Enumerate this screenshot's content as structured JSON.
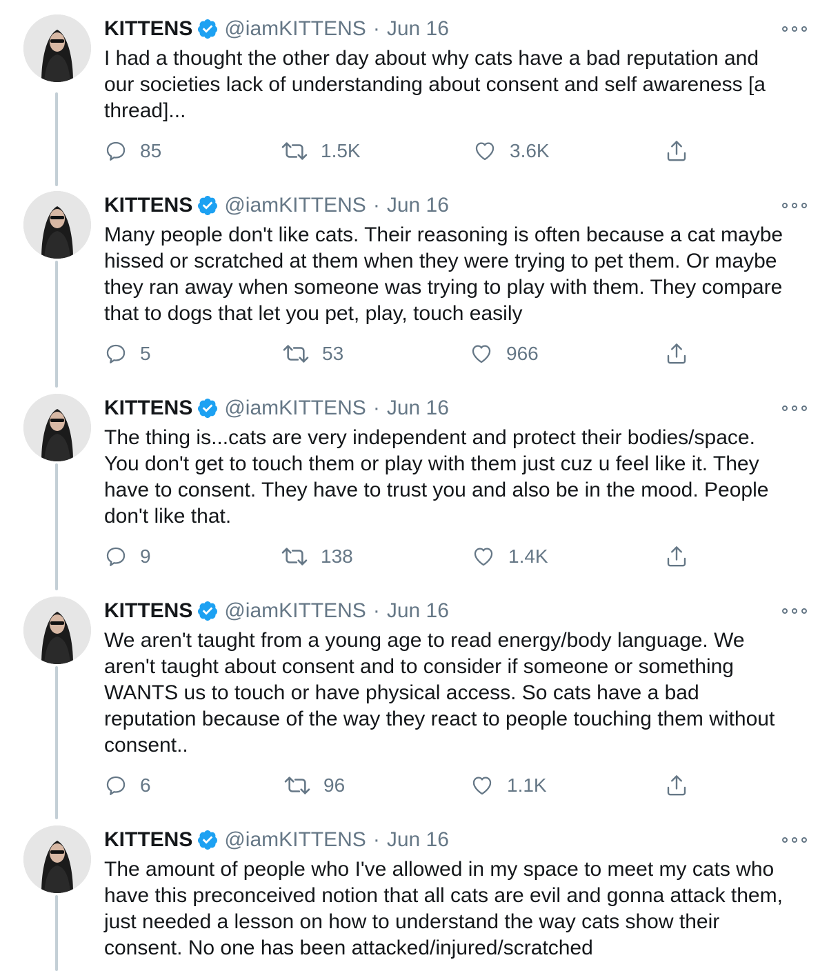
{
  "tweets": [
    {
      "name": "KITTENS",
      "handle": "@iamKITTENS",
      "separator": "·",
      "date": "Jun 16",
      "text": "I had a thought the other day about why cats have a bad reputation and\nour societies lack of understanding about consent and self awareness [a\nthread]...",
      "replies": "85",
      "retweets": "1.5K",
      "likes": "3.6K"
    },
    {
      "name": "KITTENS",
      "handle": "@iamKITTENS",
      "separator": "·",
      "date": "Jun 16",
      "text": "Many people don't like cats. Their reasoning is often because a cat maybe\nhissed or scratched at them when they were trying to pet them. Or maybe\nthey ran away when someone was trying to play with them. They compare\nthat to dogs that let you pet, play, touch easily",
      "replies": "5",
      "retweets": "53",
      "likes": "966"
    },
    {
      "name": "KITTENS",
      "handle": "@iamKITTENS",
      "separator": "·",
      "date": "Jun 16",
      "text": "The thing is...cats are very independent and protect their bodies/space.\nYou don't get to touch them or play with them just cuz u feel like it. They\nhave to consent. They have to trust you and also be in the mood. People\ndon't like that.",
      "replies": "9",
      "retweets": "138",
      "likes": "1.4K"
    },
    {
      "name": "KITTENS",
      "handle": "@iamKITTENS",
      "separator": "·",
      "date": "Jun 16",
      "text": "We aren't taught from a young age to read energy/body language. We\naren't taught about consent and to consider if someone or something\nWANTS us to touch or have physical access. So cats have a bad\nreputation because of the way they react to people touching them without\nconsent..",
      "replies": "6",
      "retweets": "96",
      "likes": "1.1K"
    },
    {
      "name": "KITTENS",
      "handle": "@iamKITTENS",
      "separator": "·",
      "date": "Jun 16",
      "text": "The amount of people who I've allowed in my space to meet my cats who\nhave this preconceived notion that all cats are evil and gonna attack them,\njust needed a lesson on how to understand the way cats show their\nconsent. No one has been attacked/injured/scratched"
    }
  ],
  "icons": {
    "reply": "reply-icon",
    "retweet": "retweet-icon",
    "like": "heart-icon",
    "share": "share-icon",
    "verified": "verified-badge-icon",
    "more": "more-options-icon"
  },
  "colors": {
    "text": "#14171a",
    "muted": "#657786",
    "verified": "#1da1f2",
    "thread_line": "#c4cfd6"
  }
}
